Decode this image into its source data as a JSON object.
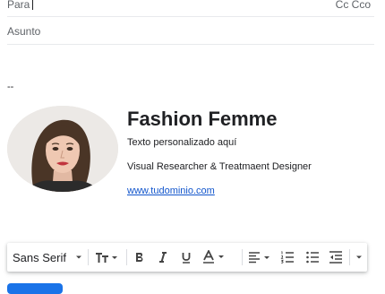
{
  "compose": {
    "to_label": "Para",
    "cc_label": "Cc Cco",
    "subject_placeholder": "Asunto"
  },
  "signature": {
    "separator": "--",
    "name": "Fashion Femme",
    "line1": "Texto personalizado aquí",
    "line2": "Visual Researcher & Treatmaent Designer",
    "link": "www.tudominio.com"
  },
  "toolbar": {
    "font": "Sans Serif",
    "buttons": [
      "text-size",
      "bold",
      "italic",
      "underline",
      "text-color",
      "align",
      "numbered-list",
      "bulleted-list",
      "indent-less",
      "more-formatting"
    ]
  },
  "colors": {
    "accent": "#1a73e8",
    "link": "#1155cc"
  }
}
